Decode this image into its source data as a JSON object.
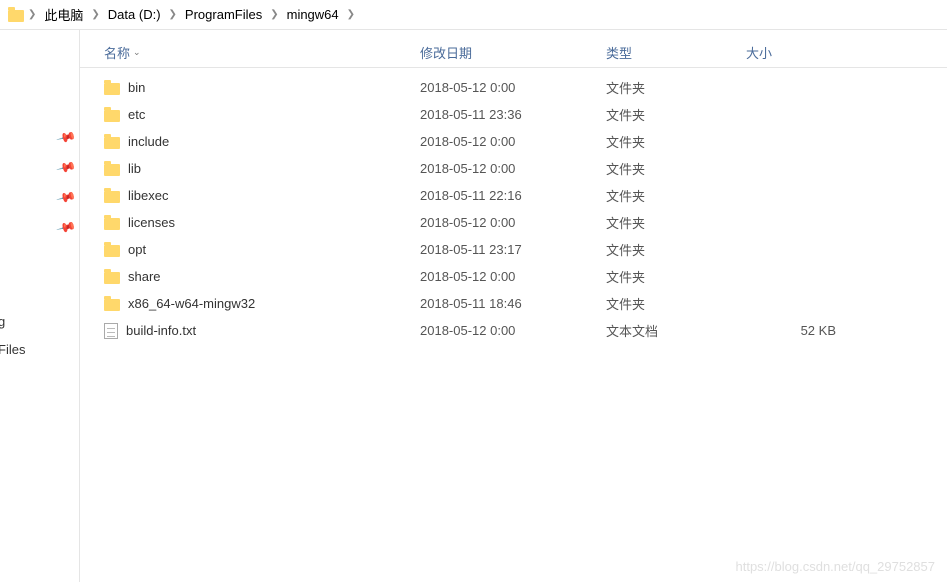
{
  "breadcrumb": {
    "segments": [
      {
        "label": "此电脑"
      },
      {
        "label": "Data (D:)"
      },
      {
        "label": "ProgramFiles"
      },
      {
        "label": "mingw64"
      }
    ]
  },
  "columns": {
    "name": "名称",
    "date": "修改日期",
    "type": "类型",
    "size": "大小"
  },
  "sidebar": {
    "frag1": "g",
    "frag2": "Files"
  },
  "rows": [
    {
      "icon": "folder",
      "name": "bin",
      "date": "2018-05-12 0:00",
      "type": "文件夹",
      "size": ""
    },
    {
      "icon": "folder",
      "name": "etc",
      "date": "2018-05-11 23:36",
      "type": "文件夹",
      "size": ""
    },
    {
      "icon": "folder",
      "name": "include",
      "date": "2018-05-12 0:00",
      "type": "文件夹",
      "size": ""
    },
    {
      "icon": "folder",
      "name": "lib",
      "date": "2018-05-12 0:00",
      "type": "文件夹",
      "size": ""
    },
    {
      "icon": "folder",
      "name": "libexec",
      "date": "2018-05-11 22:16",
      "type": "文件夹",
      "size": ""
    },
    {
      "icon": "folder",
      "name": "licenses",
      "date": "2018-05-12 0:00",
      "type": "文件夹",
      "size": ""
    },
    {
      "icon": "folder",
      "name": "opt",
      "date": "2018-05-11 23:17",
      "type": "文件夹",
      "size": ""
    },
    {
      "icon": "folder",
      "name": "share",
      "date": "2018-05-12 0:00",
      "type": "文件夹",
      "size": ""
    },
    {
      "icon": "folder",
      "name": "x86_64-w64-mingw32",
      "date": "2018-05-11 18:46",
      "type": "文件夹",
      "size": ""
    },
    {
      "icon": "file",
      "name": "build-info.txt",
      "date": "2018-05-12 0:00",
      "type": "文本文档",
      "size": "52 KB"
    }
  ],
  "watermark": "https://blog.csdn.net/qq_29752857"
}
